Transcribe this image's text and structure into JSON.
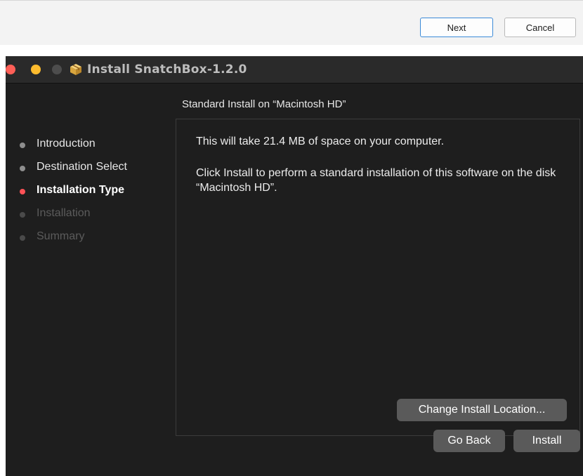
{
  "wizard": {
    "next_label": "Next",
    "cancel_label": "Cancel"
  },
  "window": {
    "title": "Install SnatchBox-1.2.0",
    "traffic_lights": {
      "close": "#fe5f57",
      "minimize": "#febc2e",
      "zoom": "#4d4d4d"
    },
    "icon": "package-icon"
  },
  "subtitle": "Standard Install on “Macintosh HD”",
  "steps": [
    {
      "label": "Introduction",
      "state": "done"
    },
    {
      "label": "Destination Select",
      "state": "done"
    },
    {
      "label": "Installation Type",
      "state": "current"
    },
    {
      "label": "Installation",
      "state": "todo"
    },
    {
      "label": "Summary",
      "state": "todo"
    }
  ],
  "content": {
    "space_text": "This will take 21.4 MB of space on your computer.",
    "instruction_text": "Click Install to perform a standard installation of this software on the disk “Macintosh HD”.",
    "change_location_label": "Change Install Location..."
  },
  "footer": {
    "go_back_label": "Go Back",
    "install_label": "Install"
  },
  "colors": {
    "current_step_dot": "#ff5257",
    "next_button_border": "#3b8ad8",
    "window_background": "#1e1e1e"
  }
}
